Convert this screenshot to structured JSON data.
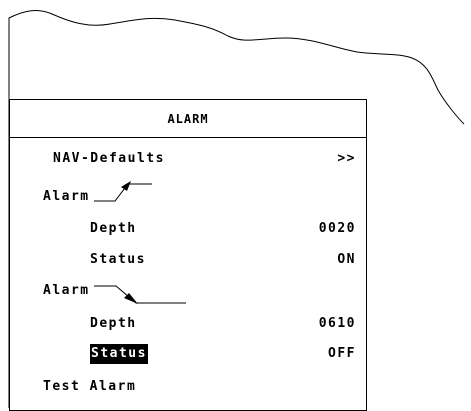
{
  "menu": {
    "title": "ALARM",
    "items": [
      {
        "label": "NAV-Defaults",
        "value": ">>"
      },
      {
        "label": "Alarm",
        "value": ""
      },
      {
        "label": "Depth",
        "value": "0020"
      },
      {
        "label": "Status",
        "value": "ON"
      },
      {
        "label": "Alarm",
        "value": ""
      },
      {
        "label": "Depth",
        "value": "0610"
      },
      {
        "label": "Status",
        "value": "OFF"
      },
      {
        "label": "Test Alarm",
        "value": ""
      }
    ],
    "selected_item": "Status",
    "icons": [
      "arrow-up-right-icon",
      "arrow-down-right-icon"
    ]
  }
}
